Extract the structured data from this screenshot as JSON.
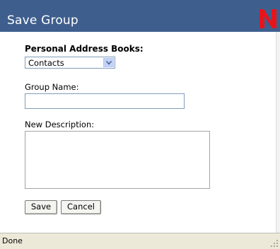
{
  "dialog": {
    "title": "Save Group",
    "logo_letter": "N"
  },
  "form": {
    "address_books_label": "Personal Address Books:",
    "address_book_selected": "Contacts",
    "group_name_label": "Group Name:",
    "group_name_value": "",
    "description_label": "New Description:",
    "description_value": ""
  },
  "buttons": {
    "save": "Save",
    "cancel": "Cancel"
  },
  "status": {
    "text": "Done"
  },
  "colors": {
    "titlebar": "#3e5f8e",
    "logo": "#e8141c"
  }
}
